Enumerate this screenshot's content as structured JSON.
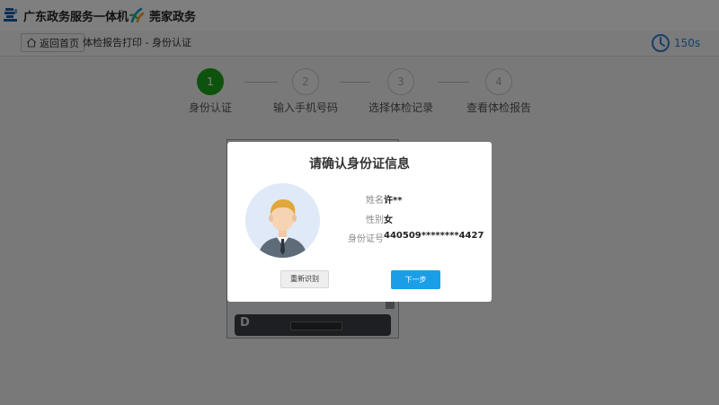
{
  "header": {
    "app_title": "广东政务服务一体机",
    "partner_title": "莞家政务"
  },
  "nav": {
    "home_label": "返回首页",
    "page_title": "体检报告打印 - 身份认证",
    "countdown": "150s"
  },
  "steps": [
    {
      "number": "1",
      "label": "身份认证",
      "active": true
    },
    {
      "number": "2",
      "label": "输入手机号码",
      "active": false
    },
    {
      "number": "3",
      "label": "选择体检记录",
      "active": false
    },
    {
      "number": "4",
      "label": "查看体检报告",
      "active": false
    }
  ],
  "device": {
    "label": "D"
  },
  "dialog": {
    "title": "请确认身份证信息",
    "fields": [
      {
        "label": "姓名",
        "value": "许**"
      },
      {
        "label": "性别",
        "value": "女"
      },
      {
        "label": "身份证号",
        "value": "440509********4427"
      }
    ],
    "rescan_label": "重新识别",
    "next_label": "下一步"
  },
  "colors": {
    "active_step": "#1aa61a",
    "primary_button": "#1a9ee8",
    "timer": "#2f7fd0",
    "overlay": "rgba(0,0,0,0.5)"
  }
}
